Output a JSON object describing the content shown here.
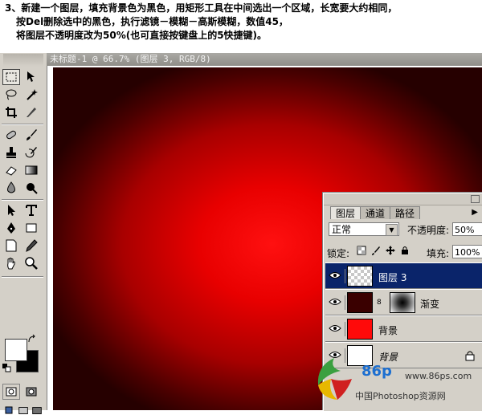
{
  "instructions": {
    "line1": "3、新建一个图层，填充背景色为黑色，用矩形工具在中间选出一个区域，长宽要大约相同，",
    "line2": "按Del删除选中的黑色，执行滤镜－模糊－高斯模糊，数值45，",
    "line3": "将图层不透明度改为50%(也可直接按键盘上的5快捷键)。"
  },
  "document": {
    "title": "未标题-1 @ 66.7% (图层 3, RGB/8)"
  },
  "layers_panel": {
    "tabs": [
      "图层",
      "通道",
      "路径"
    ],
    "active_tab": "图层",
    "blend_mode": "正常",
    "opacity_label": "不透明度:",
    "opacity_value": "50%",
    "lock_label": "锁定:",
    "fill_label": "填充:",
    "fill_value": "100%",
    "layers": [
      {
        "name": "图层 3",
        "selected": true,
        "visible": true
      },
      {
        "name": "渐变",
        "selected": false,
        "visible": true,
        "has_mask": true
      },
      {
        "name": "背景",
        "selected": false,
        "visible": true
      },
      {
        "name": "背景",
        "selected": false,
        "visible": true,
        "locked": true
      }
    ]
  },
  "toolbox": {
    "foreground_color": "#ffffff",
    "background_color": "#000000",
    "icons": [
      "marquee-icon",
      "move-icon",
      "lasso-icon",
      "magic-wand-icon",
      "crop-icon",
      "slice-icon",
      "healing-icon",
      "brush-icon",
      "stamp-icon",
      "history-brush-icon",
      "eraser-icon",
      "gradient-icon",
      "blur-icon",
      "dodge-icon",
      "path-select-icon",
      "type-icon",
      "pen-icon",
      "shape-icon",
      "notes-icon",
      "eyedropper-icon",
      "hand-icon",
      "zoom-icon"
    ]
  },
  "watermark": {
    "number": "86p",
    "url": "www.86ps.com",
    "text": "中国Photoshop资源网"
  },
  "colors": {
    "canvas_center": "#ff1010",
    "canvas_edge": "#260000",
    "selection": "#0a246a"
  }
}
